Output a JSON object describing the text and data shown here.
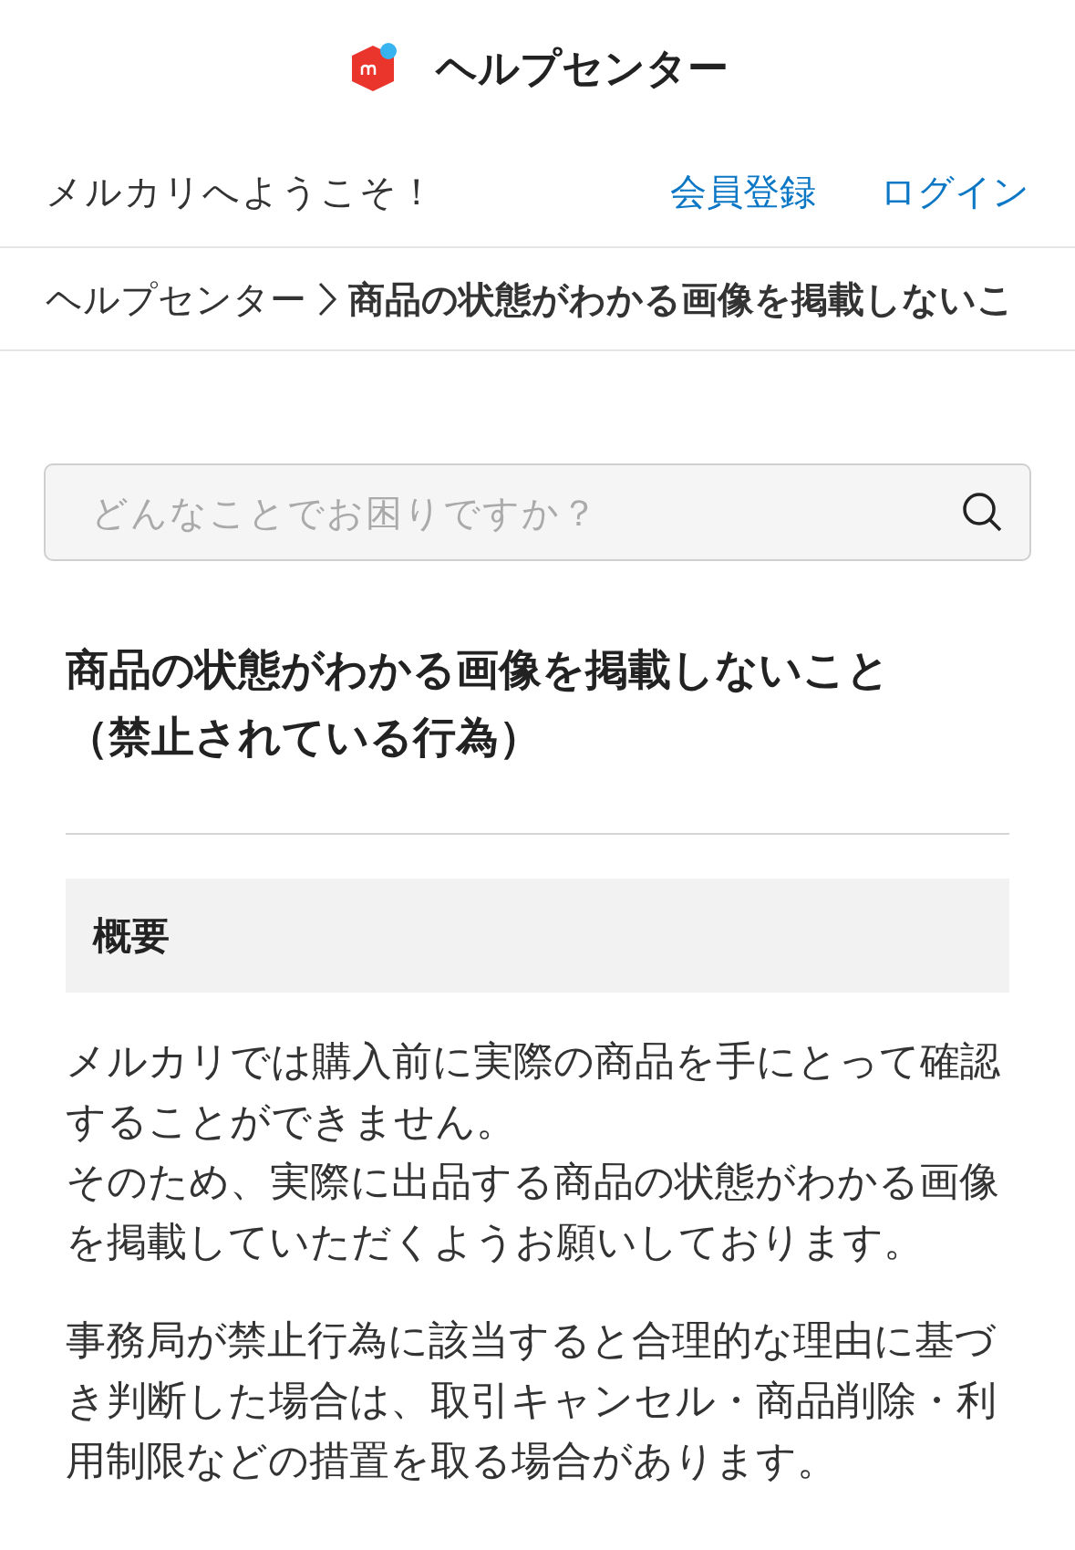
{
  "header": {
    "title": "ヘルプセンター"
  },
  "welcome": {
    "text": "メルカリへようこそ！",
    "links": [
      "会員登録",
      "ログイン"
    ]
  },
  "breadcrumb": {
    "root": "ヘルプセンター",
    "current": "商品の状態がわかる画像を掲載しないこ"
  },
  "search": {
    "placeholder": "どんなことでお困りですか？"
  },
  "article": {
    "title": "商品の状態がわかる画像を掲載しないこと（禁止されている行為）",
    "section_heading": "概要",
    "paragraphs": [
      [
        "メルカリでは購入前に実際の商品を手にとって確認することができません。",
        "そのため、実際に出品する商品の状態がわかる画像を掲載していただくようお願いしております。"
      ],
      [
        "事務局が禁止行為に該当すると合理的な理由に基づき判断した場合は、取引キャンセル・商品削除・利用制限などの措置を取る場合があります。"
      ]
    ]
  }
}
